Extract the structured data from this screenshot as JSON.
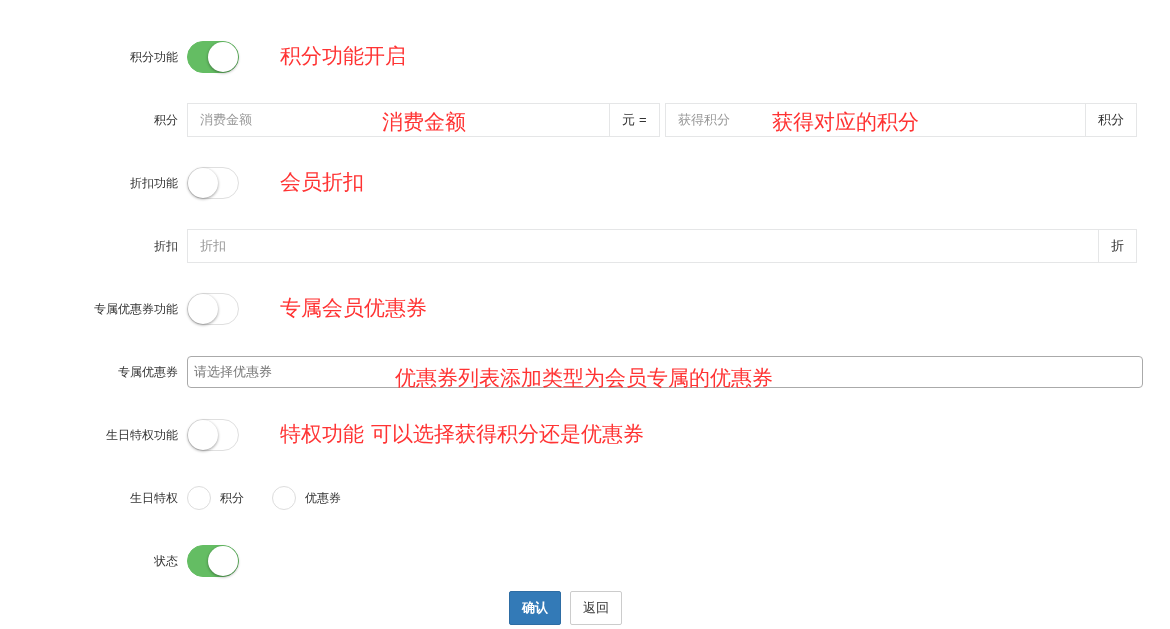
{
  "rows": [
    {
      "kind": "switch",
      "label": "积分功能",
      "on": true,
      "note": "积分功能开启"
    },
    {
      "kind": "group",
      "label": "积分",
      "fields": [
        {
          "placeholder": "消费金额",
          "addon": "元 =",
          "note": "消费金额"
        },
        {
          "placeholder": "获得积分",
          "addon": "积分",
          "note": "获得对应的积分"
        }
      ]
    },
    {
      "kind": "switch",
      "label": "折扣功能",
      "on": false,
      "note": "会员折扣"
    },
    {
      "kind": "group",
      "label": "折扣",
      "fields": [
        {
          "placeholder": "折扣",
          "addon": "折"
        }
      ]
    },
    {
      "kind": "switch",
      "label": "专属优惠券功能",
      "on": false,
      "note": "专属会员优惠券"
    },
    {
      "kind": "select",
      "label": "专属优惠券",
      "placeholder": "请选择优惠券",
      "note": "优惠券列表添加类型为会员专属的优惠券"
    },
    {
      "kind": "switch",
      "label": "生日特权功能",
      "on": false,
      "note": "特权功能  可以选择获得积分还是优惠券"
    },
    {
      "kind": "radio",
      "label": "生日特权",
      "options": [
        {
          "label": "积分",
          "selected": false
        },
        {
          "label": "优惠券",
          "selected": false
        }
      ]
    },
    {
      "kind": "switch",
      "label": "状态",
      "on": true
    }
  ],
  "buttons": [
    {
      "label": "确认",
      "kind": "primary"
    },
    {
      "label": "返回",
      "kind": "default"
    }
  ]
}
